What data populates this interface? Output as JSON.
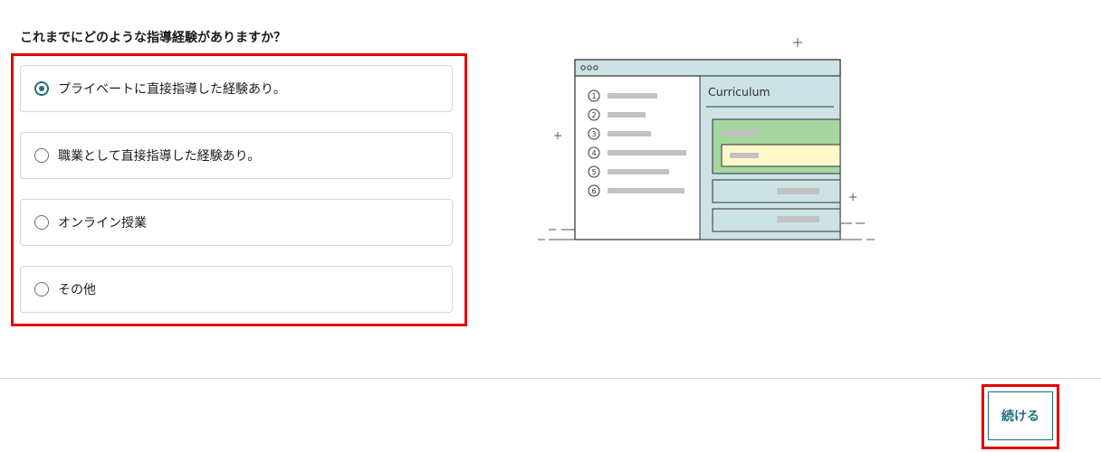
{
  "question": {
    "text": "これまでにどのような指導経験がありますか？"
  },
  "options": [
    {
      "label": "プライベートに直接指導した経験あり。",
      "selected": true
    },
    {
      "label": "職業として直接指導した経験あり。",
      "selected": false
    },
    {
      "label": "オンライン授業",
      "selected": false
    },
    {
      "label": "その他",
      "selected": false
    }
  ],
  "illustration": {
    "window_title": "Curriculum",
    "list_numbers": [
      "1",
      "2",
      "3",
      "4",
      "5",
      "6"
    ]
  },
  "footer": {
    "continue_label": "続ける"
  },
  "colors": {
    "accent": "#1e6f7a",
    "highlight_border": "#e50000",
    "card_border": "#d1d7dc",
    "illustration_panel": "#cde2e5",
    "illustration_green": "#a6d7a1",
    "illustration_yellow": "#fff8c9"
  }
}
